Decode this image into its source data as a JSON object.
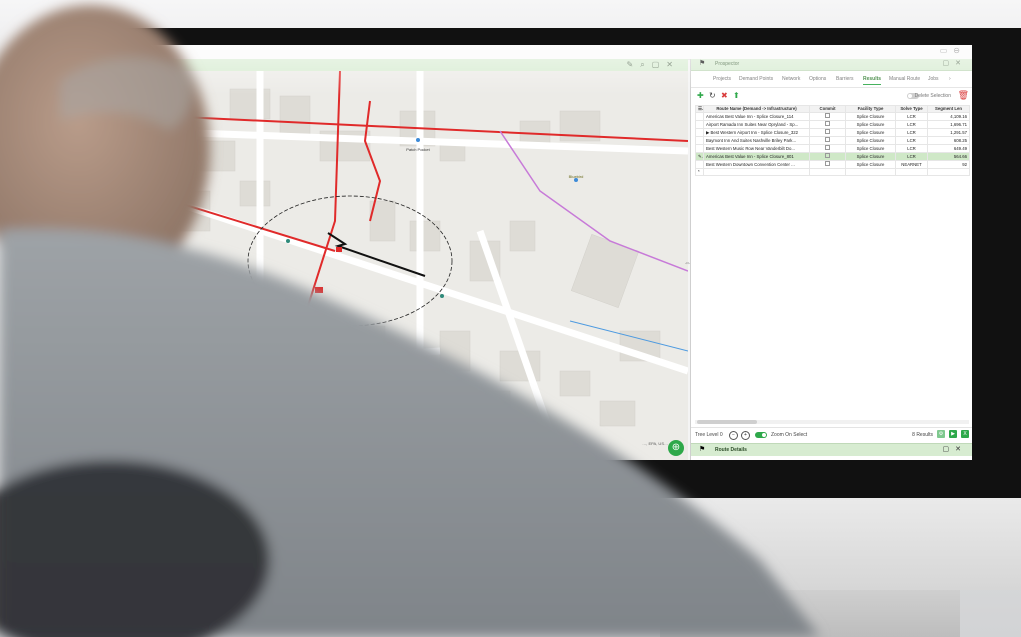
{
  "app": {
    "map_panel": {
      "poi_labels": [
        "Patch Pocket",
        "Bluebird"
      ],
      "credit": "…, EPA, US…"
    },
    "right_panel": {
      "title": "Prospector",
      "tabs": [
        "Projects",
        "Demand Points",
        "Network",
        "Options",
        "Barriers",
        "Results",
        "Manual Route",
        "Jobs"
      ],
      "active_tab": "Results",
      "delete_selection_label": "Delete Selection",
      "table": {
        "columns": [
          "Route Name (Demand -> Infrastructure)",
          "Commit",
          "Facility Type",
          "Solve Type",
          "Segment Len"
        ],
        "rows": [
          {
            "name": "Americas Best Value Inn - Splice Closure_114",
            "facility": "Splice Closure",
            "solve": "LCR",
            "length": "4,109.16",
            "selected": false
          },
          {
            "name": "Airport Ramada Inn Suites Near Opryland - Sp...",
            "facility": "Splice Closure",
            "solve": "LCR",
            "length": "1,696.71",
            "selected": false
          },
          {
            "name": "Best Western Airport Inn - Splice Closure_322",
            "facility": "Splice Closure",
            "solve": "LCR",
            "length": "1,291.57",
            "selected": false
          },
          {
            "name": "Baymont Inn And Suites Nashville Briley Park...",
            "facility": "Splice Closure",
            "solve": "LCR",
            "length": "608.25",
            "selected": false
          },
          {
            "name": "Best Western Music Row Near Vanderbilt Do...",
            "facility": "Splice Closure",
            "solve": "LCR",
            "length": "649.49",
            "selected": false
          },
          {
            "name": "Americas Best Value Inn - Splice Closure_801",
            "facility": "Splice Closure",
            "solve": "LCR",
            "length": "564.66",
            "selected": true
          },
          {
            "name": "Best Western Downtown Convention Center ...",
            "facility": "Splice Closure",
            "solve": "NEARNET",
            "length": "92",
            "selected": false
          }
        ]
      },
      "tree_level_label": "Tree Level 0",
      "zoom_on_select_label": "Zoom On Select",
      "results_count": "8 Results",
      "route_details_title": "Route Details"
    }
  },
  "colors": {
    "accent": "#2ea84a",
    "header_green": "#d7ecd1",
    "route_red": "#e02a2a",
    "selected_row": "#cfe8c7"
  }
}
